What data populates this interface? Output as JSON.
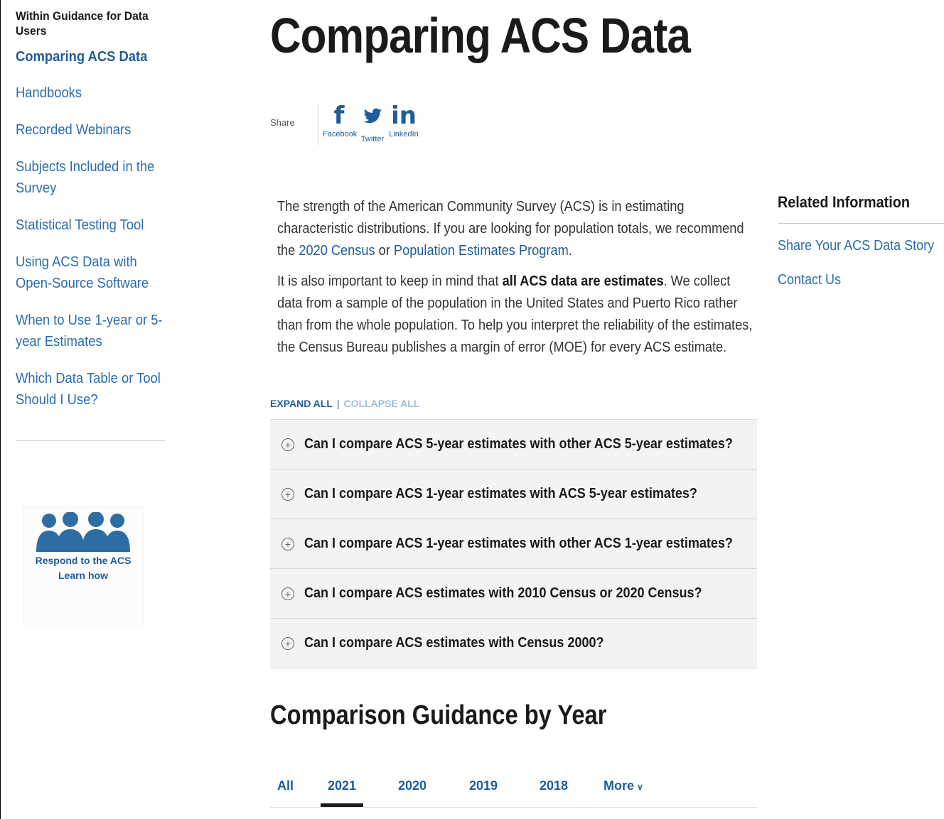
{
  "sidebar": {
    "heading": "Within Guidance for Data Users",
    "items": [
      {
        "label": "Comparing ACS Data"
      },
      {
        "label": "Handbooks"
      },
      {
        "label": "Recorded Webinars"
      },
      {
        "label": "Subjects Included in the Survey"
      },
      {
        "label": "Statistical Testing Tool"
      },
      {
        "label": "Using ACS Data with Open-Source Software"
      },
      {
        "label": "When to Use 1-year or 5-year Estimates"
      },
      {
        "label": "Which Data Table or Tool Should I Use?"
      }
    ],
    "respond": {
      "line1": "Respond to the ACS",
      "line2": "Learn how",
      "icon": "people-group-icon"
    }
  },
  "main": {
    "title": "Comparing ACS Data",
    "share": {
      "label": "Share",
      "items": [
        {
          "glyph": "f",
          "name": "Facebook",
          "icon": "facebook-icon"
        },
        {
          "glyph": "🐦",
          "name": "Twitter",
          "icon": "twitter-icon"
        },
        {
          "glyph": "in",
          "name": "LinkedIn",
          "icon": "linkedin-icon"
        }
      ]
    },
    "intro": {
      "p1_a": "The strength of the American Community Survey (ACS) is in estimating characteristic distributions. If you are looking for population totals, we recommend the ",
      "p1_link1": "2020 Census",
      "p1_b": " or ",
      "p1_link2": "Population Estimates Program",
      "p1_c": ".",
      "p2_a": "It is also important to keep in mind that ",
      "p2_bold": "all ACS data are estimates",
      "p2_b": ". We collect data from a sample of the population in the United States and Puerto Rico rather than from the whole population. To help you interpret the reliability of the estimates, the Census Bureau publishes a margin of error (MOE) for every ACS estimate."
    },
    "expand_all": "EXPAND ALL",
    "separator": "|",
    "collapse_all": "COLLAPSE ALL",
    "faqs": [
      {
        "q": "Can I compare ACS 5-year estimates with other ACS 5-year estimates?"
      },
      {
        "q": "Can I compare ACS 1-year estimates with ACS 5-year estimates?"
      },
      {
        "q": "Can I compare ACS 1-year estimates with other ACS 1-year estimates?"
      },
      {
        "q": "Can I compare ACS estimates with 2010 Census or 2020 Census?"
      },
      {
        "q": "Can I compare ACS estimates with Census 2000?"
      }
    ],
    "guidance_heading": "Comparison Guidance by Year",
    "year_tabs": {
      "all": "All",
      "y2021": "2021",
      "y2020": "2020",
      "y2019": "2019",
      "y2018": "2018",
      "more": "More",
      "more_chevron": "∨",
      "active": "2021"
    }
  },
  "related": {
    "title": "Related Information",
    "links": [
      {
        "label": "Share Your ACS Data Story"
      },
      {
        "label": "Contact Us"
      }
    ]
  },
  "colors": {
    "link": "#2b6cb0",
    "brand_blue": "#1f5c99",
    "panel": "#f3f3f3"
  }
}
